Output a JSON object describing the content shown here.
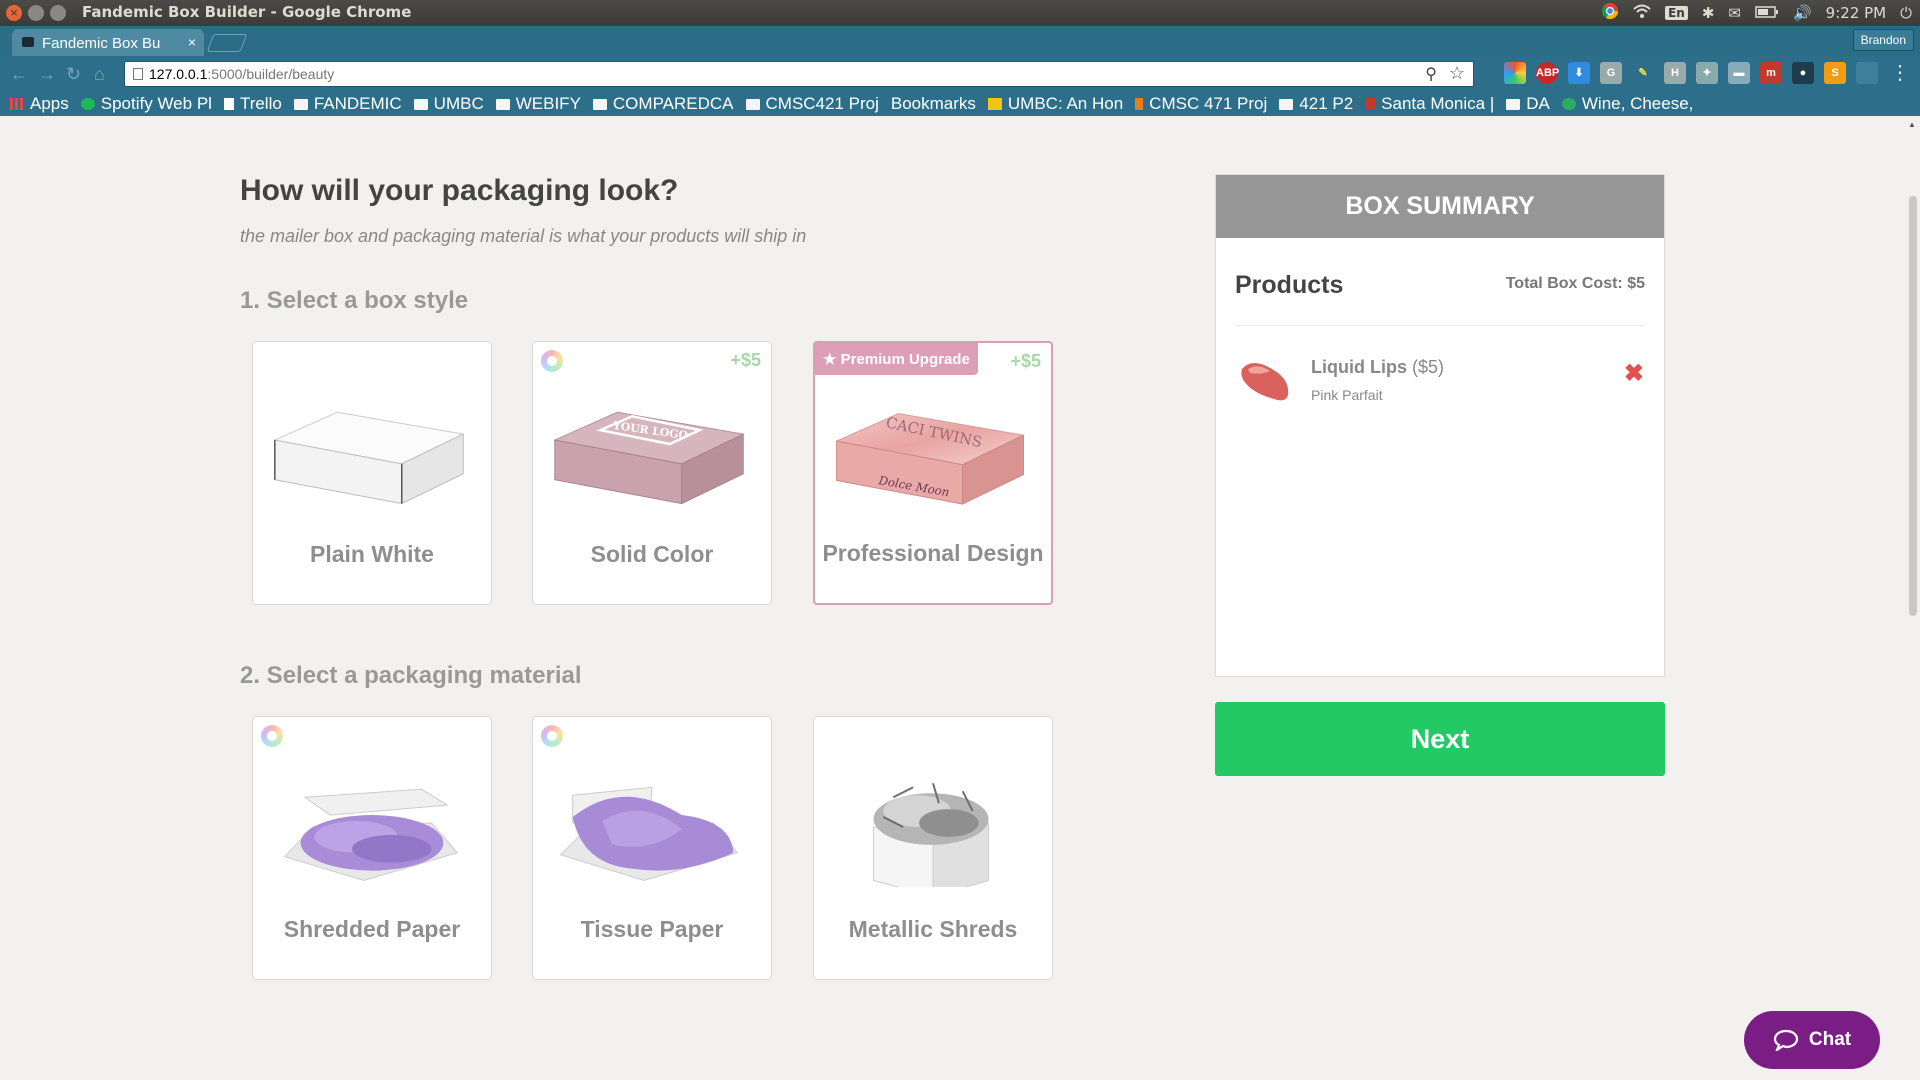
{
  "window": {
    "title": "Fandemic Box Builder - Google Chrome"
  },
  "tray": {
    "lang": "En",
    "clock": "9:22 PM",
    "bluetooth": "✱",
    "mail": "✉",
    "volume": "🔊"
  },
  "tab": {
    "title": "Fandemic Box Bu",
    "close": "×"
  },
  "profile": "Brandon",
  "toolbar": {
    "url_host": "127.0.0.1",
    "url_path": ":5000/builder/beauty"
  },
  "bookmarks": [
    {
      "label": "Apps"
    },
    {
      "label": "Spotify Web Pl"
    },
    {
      "label": "Trello"
    },
    {
      "label": "FANDEMIC"
    },
    {
      "label": "UMBC"
    },
    {
      "label": "WEBIFY"
    },
    {
      "label": "COMPAREDCA"
    },
    {
      "label": "CMSC421 Proj"
    },
    {
      "label": "Bookmarks"
    },
    {
      "label": "UMBC: An Hon"
    },
    {
      "label": "CMSC 471 Proj"
    },
    {
      "label": "421 P2"
    },
    {
      "label": "Santa Monica |"
    },
    {
      "label": "DA"
    },
    {
      "label": "Wine, Cheese,"
    }
  ],
  "page": {
    "heading": "How will your packaging look?",
    "subheading": "the mailer box and packaging material is what your products will ship in",
    "section1": "1. Select a box style",
    "section2": "2. Select a packaging material",
    "box_styles": [
      {
        "label": "Plain White",
        "price": ""
      },
      {
        "label": "Solid Color",
        "price": "+$5",
        "logo_text": "YOUR LOGO"
      },
      {
        "label": "Professional Design",
        "price": "+$5",
        "badge": "★ Premium Upgrade",
        "art_text": "CACI TWINS",
        "art_script": "Dolce Moon"
      }
    ],
    "materials": [
      {
        "label": "Shredded Paper"
      },
      {
        "label": "Tissue Paper"
      },
      {
        "label": "Metallic Shreds"
      }
    ]
  },
  "summary": {
    "header": "BOX SUMMARY",
    "products_title": "Products",
    "total": "Total Box Cost: $5",
    "item": {
      "name": "Liquid Lips",
      "price": "($5)",
      "variant": "Pink Parfait",
      "remove": "✖"
    }
  },
  "next_label": "Next",
  "chat_label": "Chat",
  "colors": {
    "accent_green": "#22c965",
    "chat_purple": "#7a1e86",
    "premium_pink": "#dd9fb5"
  }
}
